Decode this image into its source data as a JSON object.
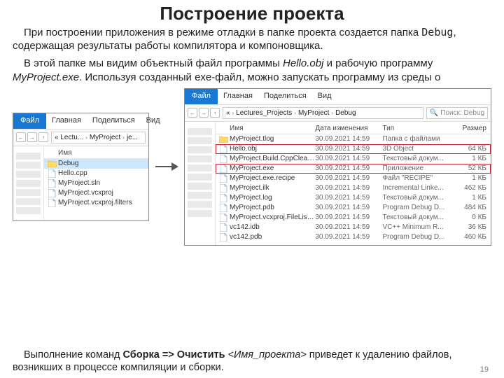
{
  "page_number": "19",
  "title": "Построение проекта",
  "para1_a": "При построении приложения в режиме отладки в папке проекта создается папка ",
  "para1_b": "Debug",
  "para1_c": ", содержащая результаты работы компилятора и компоновщика.",
  "para2_a": "В этой папке мы видим объектный файл программы ",
  "para2_b": "Hello.obj",
  "para2_c": " и рабочую программу ",
  "para2_d": "MyProject.exe",
  "para2_e": ". Используя созданный exe-файл, можно запускать программу из среды о",
  "bottom_a": "Выполнение команд ",
  "bottom_b": "Сборка => Очистить ",
  "bottom_c": "<Имя_проекта>",
  "bottom_d": " приведет к удалению файлов, возникших в процессе компиляции и сборки.",
  "ribbon": {
    "file": "Файл",
    "t1": "Главная",
    "t2": "Поделиться",
    "t3": "Вид"
  },
  "win_small": {
    "crumbs": [
      "« Lectu...",
      "MyProject",
      "je..."
    ],
    "col_name": "Имя",
    "items": [
      {
        "icon": "folder",
        "name": "Debug",
        "selected": true
      },
      {
        "icon": "file",
        "name": "Hello.cpp"
      },
      {
        "icon": "file",
        "name": "MyProject.sln"
      },
      {
        "icon": "file",
        "name": "MyProject.vcxproj"
      },
      {
        "icon": "file",
        "name": "MyProject.vcxproj.filters"
      }
    ]
  },
  "win_large": {
    "crumbs": [
      "«",
      "Lectures_Projects",
      "MyProject",
      "Debug"
    ],
    "search_ph": "Поиск: Debug",
    "cols": {
      "name": "Имя",
      "date": "Дата изменения",
      "type": "Тип",
      "size": "Размер"
    },
    "items": [
      {
        "icon": "folder",
        "name": "MyProject.tlog",
        "date": "30.09.2021 14:59",
        "type": "Папка с файлами",
        "size": ""
      },
      {
        "icon": "file",
        "name": "Hello.obj",
        "date": "30.09.2021 14:59",
        "type": "3D Object",
        "size": "64 КБ",
        "boxed": true
      },
      {
        "icon": "file",
        "name": "MyProject.Build.CppClean.log",
        "date": "30.09.2021 14:59",
        "type": "Текстовый докум...",
        "size": "1 КБ"
      },
      {
        "icon": "file",
        "name": "MyProject.exe",
        "date": "30.09.2021 14:59",
        "type": "Приложение",
        "size": "52 КБ",
        "boxed": true
      },
      {
        "icon": "file",
        "name": "MyProject.exe.recipe",
        "date": "30.09.2021 14:59",
        "type": "Файл \"RECIPE\"",
        "size": "1 КБ"
      },
      {
        "icon": "file",
        "name": "MyProject.ilk",
        "date": "30.09.2021 14:59",
        "type": "Incremental Linke...",
        "size": "462 КБ"
      },
      {
        "icon": "file",
        "name": "MyProject.log",
        "date": "30.09.2021 14:59",
        "type": "Текстовый докум...",
        "size": "1 КБ"
      },
      {
        "icon": "file",
        "name": "MyProject.pdb",
        "date": "30.09.2021 14:59",
        "type": "Program Debug D...",
        "size": "484 КБ"
      },
      {
        "icon": "file",
        "name": "MyProject.vcxproj.FileListAbsolute.txt",
        "date": "30.09.2021 14:59",
        "type": "Текстовый докум...",
        "size": "0 КБ"
      },
      {
        "icon": "file",
        "name": "vc142.idb",
        "date": "30.09.2021 14:59",
        "type": "VC++ Minimum R...",
        "size": "36 КБ"
      },
      {
        "icon": "file",
        "name": "vc142.pdb",
        "date": "30.09.2021 14:59",
        "type": "Program Debug D...",
        "size": "460 КБ"
      }
    ]
  }
}
